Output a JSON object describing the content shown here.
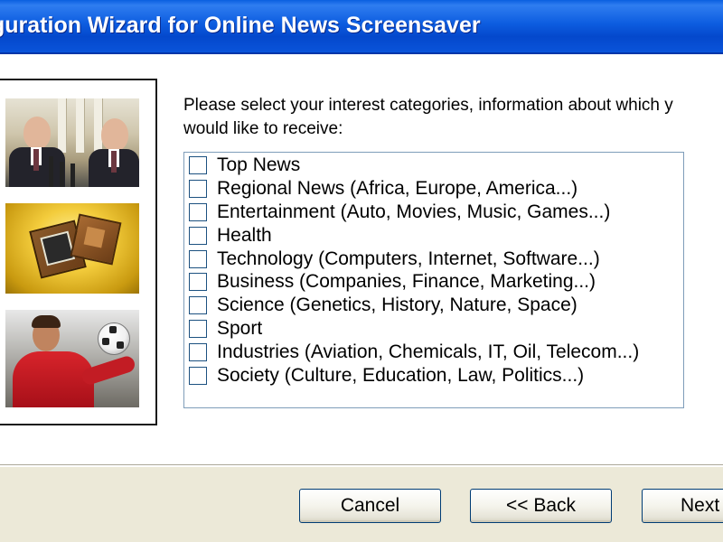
{
  "window": {
    "title": "guration Wizard for Online News Screensaver"
  },
  "instructions": {
    "line1": "Please select your interest categories, information about which y",
    "line2": "would like to receive:"
  },
  "categories": [
    {
      "label": "Top News",
      "checked": false
    },
    {
      "label": "Regional News (Africa, Europe, America...)",
      "checked": false
    },
    {
      "label": "Entertainment (Auto, Movies, Music, Games...)",
      "checked": false
    },
    {
      "label": "Health",
      "checked": false
    },
    {
      "label": "Technology (Computers, Internet, Software...)",
      "checked": false
    },
    {
      "label": "Business (Companies, Finance, Marketing...)",
      "checked": false
    },
    {
      "label": "Science (Genetics, History, Nature, Space)",
      "checked": false
    },
    {
      "label": "Sport",
      "checked": false
    },
    {
      "label": "Industries (Aviation, Chemicals, IT, Oil, Telecom...)",
      "checked": false
    },
    {
      "label": "Society (Culture, Education, Law, Politics...)",
      "checked": false
    }
  ],
  "buttons": {
    "cancel": "Cancel",
    "back": "<< Back",
    "next": "Next"
  },
  "colors": {
    "titlebar": "#0a54da",
    "dialog_background": "#ece9d8",
    "checkbox_border": "#1c5180",
    "button_border": "#003c74"
  }
}
